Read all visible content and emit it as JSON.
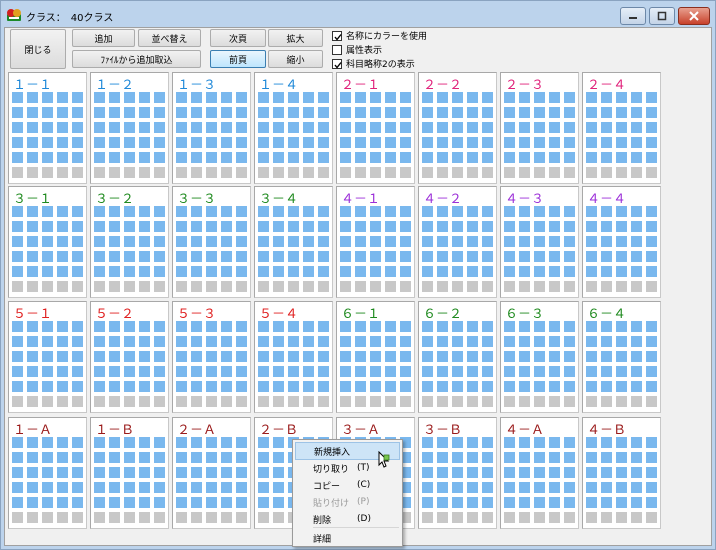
{
  "window": {
    "title": "クラス：　40クラス"
  },
  "toolbar": {
    "close": "閉じる",
    "add": "追加",
    "sort": "並べ替え",
    "import": "ﾌｧｲﾙから追加取込",
    "next": "次頁",
    "prev": "前頁",
    "zoom_in": "拡大",
    "zoom_out": "縮小"
  },
  "options": [
    {
      "label": "名称にカラーを使用",
      "checked": true
    },
    {
      "label": "属性表示",
      "checked": false
    },
    {
      "label": "科目略称2の表示",
      "checked": true
    }
  ],
  "colors": {
    "blue": "#1e88d8",
    "magenta": "#e0207a",
    "green": "#1e8a1e",
    "purple": "#9b2fd8",
    "red": "#e02020",
    "darkred": "#9a1a1a",
    "cell": "#7ab8ee",
    "cell_empty": "#c8c8c8"
  },
  "classes": [
    {
      "name": "１－１",
      "color": "blue"
    },
    {
      "name": "１－２",
      "color": "blue"
    },
    {
      "name": "１－３",
      "color": "blue"
    },
    {
      "name": "１－４",
      "color": "blue"
    },
    {
      "name": "２－１",
      "color": "magenta"
    },
    {
      "name": "２－２",
      "color": "magenta"
    },
    {
      "name": "２－３",
      "color": "magenta"
    },
    {
      "name": "２－４",
      "color": "magenta"
    },
    {
      "name": "３－１",
      "color": "green"
    },
    {
      "name": "３－２",
      "color": "green"
    },
    {
      "name": "３－３",
      "color": "green"
    },
    {
      "name": "３－４",
      "color": "green"
    },
    {
      "name": "４－１",
      "color": "purple"
    },
    {
      "name": "４－２",
      "color": "purple"
    },
    {
      "name": "４－３",
      "color": "purple"
    },
    {
      "name": "４－４",
      "color": "purple"
    },
    {
      "name": "５－１",
      "color": "red"
    },
    {
      "name": "５－２",
      "color": "red"
    },
    {
      "name": "５－３",
      "color": "red"
    },
    {
      "name": "５－４",
      "color": "red"
    },
    {
      "name": "６－１",
      "color": "green"
    },
    {
      "name": "６－２",
      "color": "green"
    },
    {
      "name": "６－３",
      "color": "green"
    },
    {
      "name": "６－４",
      "color": "green"
    },
    {
      "name": "１－Ａ",
      "color": "darkred"
    },
    {
      "name": "１－Ｂ",
      "color": "darkred"
    },
    {
      "name": "２－Ａ",
      "color": "darkred"
    },
    {
      "name": "２－Ｂ",
      "color": "darkred"
    },
    {
      "name": "３－Ａ",
      "color": "darkred"
    },
    {
      "name": "３－Ｂ",
      "color": "darkred"
    },
    {
      "name": "４－Ａ",
      "color": "darkred"
    },
    {
      "name": "４－Ｂ",
      "color": "darkred"
    }
  ],
  "context_menu": [
    {
      "label": "新規挿入",
      "shortcut": "",
      "state": "hover"
    },
    {
      "label": "切り取り",
      "shortcut": "(T)",
      "state": "normal"
    },
    {
      "label": "コピー",
      "shortcut": "(C)",
      "state": "normal"
    },
    {
      "label": "貼り付け",
      "shortcut": "(P)",
      "state": "disabled"
    },
    {
      "label": "削除",
      "shortcut": "(D)",
      "state": "normal"
    },
    {
      "label": "詳細",
      "shortcut": "",
      "state": "normal"
    }
  ]
}
